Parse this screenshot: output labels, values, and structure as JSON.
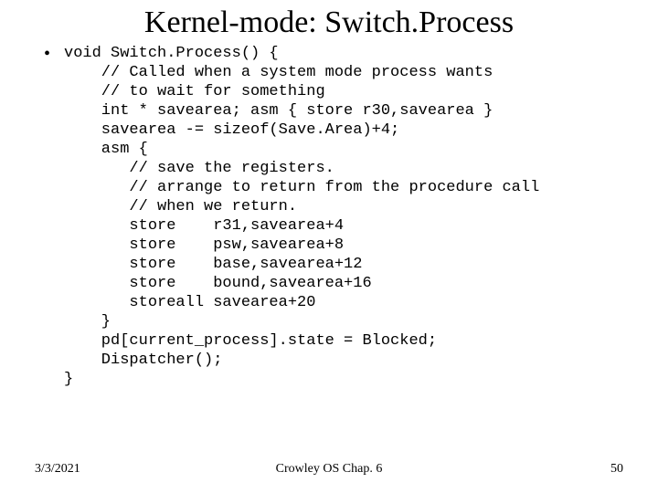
{
  "title": "Kernel-mode: Switch.Process",
  "bullet_glyph": "•",
  "code": "void Switch.Process() {\n    // Called when a system mode process wants\n    // to wait for something\n    int * savearea; asm { store r30,savearea }\n    savearea -= sizeof(Save.Area)+4;\n    asm {\n       // save the registers.\n       // arrange to return from the procedure call\n       // when we return.\n       store    r31,savearea+4\n       store    psw,savearea+8\n       store    base,savearea+12\n       store    bound,savearea+16\n       storeall savearea+20\n    }\n    pd[current_process].state = Blocked;\n    Dispatcher();\n}",
  "footer": {
    "date": "3/3/2021",
    "center": "Crowley    OS    Chap. 6",
    "page": "50"
  }
}
